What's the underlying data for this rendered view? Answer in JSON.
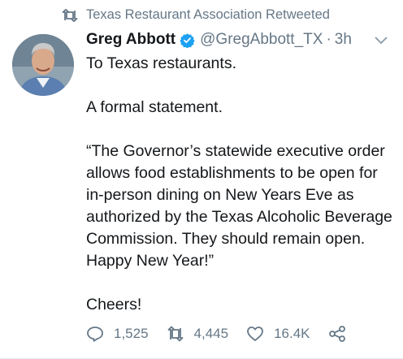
{
  "retweet_context": {
    "icon": "retweet-icon",
    "text": "Texas Restaurant Association Retweeted"
  },
  "tweet": {
    "author_name": "Greg Abbott",
    "verified": true,
    "handle": "@GregAbbott_TX",
    "separator": "·",
    "time": "3h",
    "lines": [
      "To Texas restaurants.",
      "A formal statement.",
      "“The Governor’s statewide executive order allows food establishments to be open for in-person dining on New Years Eve as authorized by the Texas Alcoholic Beverage Commission.  They should remain open. Happy New Year!”",
      "Cheers!"
    ],
    "stats": {
      "replies": "1,525",
      "retweets": "4,445",
      "likes": "16.4K"
    }
  },
  "colors": {
    "text": "#14171a",
    "muted": "#657786",
    "verified_blue": "#1da1f2",
    "divider": "#e6ecf0"
  }
}
